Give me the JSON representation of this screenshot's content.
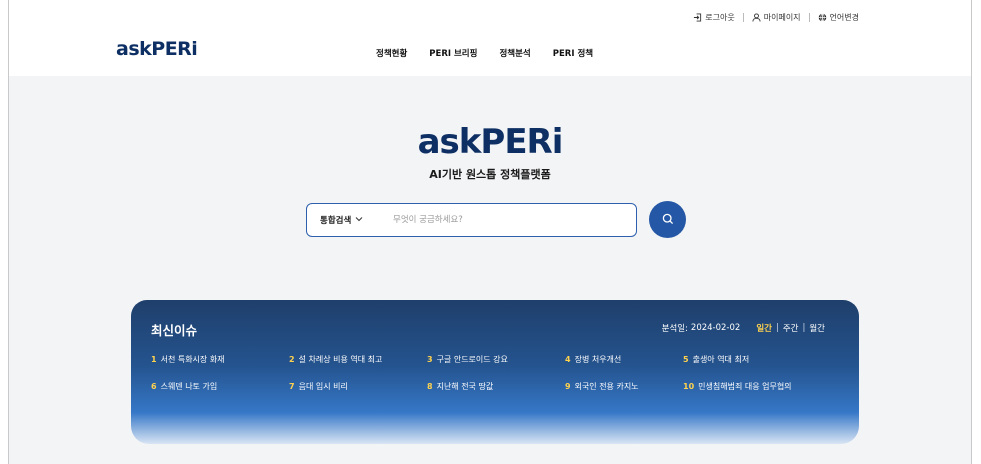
{
  "header": {
    "utility": [
      {
        "icon": "login-icon",
        "label": "로그아웃"
      },
      {
        "icon": "user-icon",
        "label": "마이페이지"
      },
      {
        "icon": "globe-icon",
        "label": "언어변경"
      }
    ],
    "logo": "askPERi",
    "nav": [
      "정책현황",
      "PERI 브리핑",
      "정책분석",
      "PERI 정책"
    ]
  },
  "hero": {
    "logo": "askPERi",
    "tagline": "AI기반 원스톱 정책플랫폼",
    "search": {
      "type_label": "통합검색",
      "placeholder": "무엇이 궁금하세요?",
      "value": ""
    }
  },
  "issues": {
    "title": "최신이슈",
    "date_label": "분석일:",
    "date": "2024-02-02",
    "periods": [
      "일간",
      "주간",
      "월간"
    ],
    "active_period": "일간",
    "items": [
      {
        "num": "1",
        "text": "서천 특화시장 화재"
      },
      {
        "num": "2",
        "text": "설 차례상 비용 역대 최고"
      },
      {
        "num": "3",
        "text": "구글 안드로이드 강요"
      },
      {
        "num": "4",
        "text": "장병 처우개선"
      },
      {
        "num": "5",
        "text": "출생아 역대 최저"
      },
      {
        "num": "6",
        "text": "스웨덴 나토 가입"
      },
      {
        "num": "7",
        "text": "음대 입시 비리"
      },
      {
        "num": "8",
        "text": "지난해 전국 땅값"
      },
      {
        "num": "9",
        "text": "외국인 전용 카지노"
      },
      {
        "num": "10",
        "text": "민생침해범죄 대응 업무협의"
      }
    ]
  },
  "colors": {
    "brand_navy": "#0d2f63",
    "search_blue": "#2457a5",
    "highlight_yellow": "#ffd24d"
  }
}
